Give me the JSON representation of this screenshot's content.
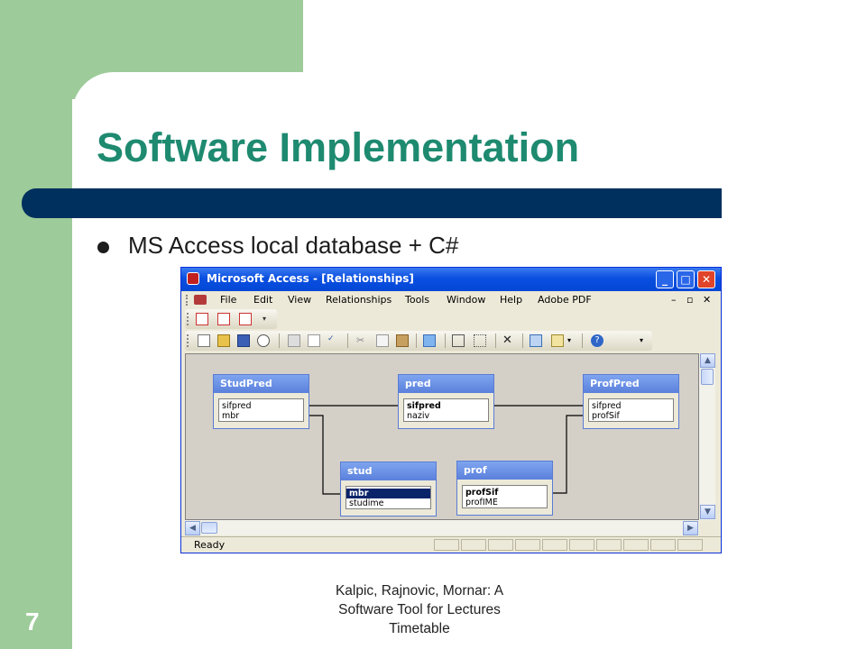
{
  "slide": {
    "title": "Software Implementation",
    "bullet": "MS Access local database + C#",
    "footer_lines": [
      "Kalpic, Rajnovic, Mornar: A",
      "Software Tool for Lectures",
      "Timetable"
    ],
    "page_number": "7"
  },
  "window": {
    "title": "Microsoft Access - [Relationships]",
    "controls": {
      "minimize": "_",
      "maximize": "□",
      "close": "✕"
    },
    "menu": [
      "File",
      "Edit",
      "View",
      "Relationships",
      "Tools",
      "Window",
      "Help",
      "Adobe PDF"
    ],
    "status": "Ready"
  },
  "tables": [
    {
      "name": "StudPred",
      "fields": [
        "sifpred",
        "mbr"
      ]
    },
    {
      "name": "pred",
      "fields": [
        "sifpred",
        "naziv"
      ]
    },
    {
      "name": "ProfPred",
      "fields": [
        "sifpred",
        "profSif"
      ]
    },
    {
      "name": "stud",
      "fields": [
        "mbr",
        "studime"
      ]
    },
    {
      "name": "prof",
      "fields": [
        "profSif",
        "profIME"
      ]
    }
  ],
  "colors": {
    "title": "#1e8a70",
    "bar": "#00305e",
    "green": "#9dcb99",
    "xp_title": "#0a4fe0"
  }
}
